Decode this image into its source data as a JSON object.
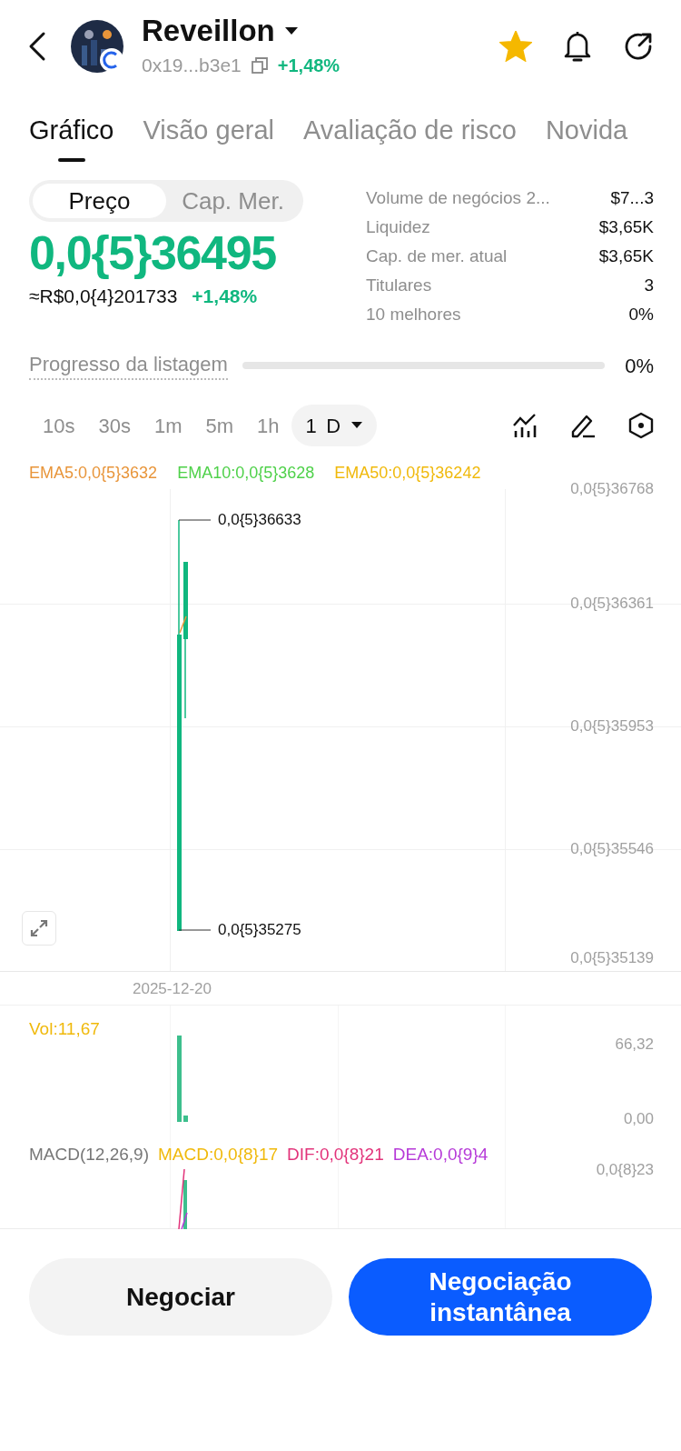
{
  "header": {
    "title": "Reveillon",
    "address": "0x19...b3e1",
    "change": "+1,48%",
    "favorite": true
  },
  "tabs": [
    {
      "label": "Gráfico",
      "selected": true
    },
    {
      "label": "Visão geral",
      "selected": false
    },
    {
      "label": "Avaliação de risco",
      "selected": false
    },
    {
      "label": "Novida",
      "selected": false
    }
  ],
  "price_toggle": [
    {
      "label": "Preço",
      "selected": true
    },
    {
      "label": "Cap. Mer.",
      "selected": false
    }
  ],
  "price": "0,0{5}36495",
  "price_brl": "≈R$0,0{4}201733",
  "price_change": "+1,48%",
  "stats": [
    {
      "label": "Volume de negócios 2...",
      "value": "$7...3"
    },
    {
      "label": "Liquidez",
      "value": "$3,65K"
    },
    {
      "label": "Cap. de mer. atual",
      "value": "$3,65K"
    },
    {
      "label": "Titulares",
      "value": "3"
    },
    {
      "label": "10 melhores",
      "value": "0%"
    }
  ],
  "listing_progress": {
    "label": "Progresso da listagem",
    "level": 0,
    "value": "0%"
  },
  "intervals": [
    {
      "label": "10s",
      "selected": false
    },
    {
      "label": "30s",
      "selected": false
    },
    {
      "label": "1m",
      "selected": false
    },
    {
      "label": "5m",
      "selected": false
    },
    {
      "label": "1h",
      "selected": false
    },
    {
      "label": "1 D",
      "selected": true
    }
  ],
  "chart": {
    "indicators": [
      {
        "text": "EMA5:0,0{5}3632",
        "color": "#e8953a"
      },
      {
        "text": "EMA10:0,0{5}3628",
        "color": "#4fd14a"
      },
      {
        "text": "EMA50:0,0{5}36242",
        "color": "#f0b90b"
      }
    ],
    "y_labels": [
      "0,0{5}36768",
      "0,0{5}36361",
      "0,0{5}35953",
      "0,0{5}35546",
      "0,0{5}35139"
    ],
    "high_label": "0,0{5}36633",
    "low_label": "0,0{5}35275",
    "date_label": "2025-12-20"
  },
  "volume": {
    "label": "Vol:11,67",
    "y_labels": [
      "66,32",
      "0,00"
    ]
  },
  "macd": {
    "label": "MACD(12,26,9)",
    "indicators": [
      {
        "text": "MACD:0,0{8}17",
        "color": "#f0b90b"
      },
      {
        "text": "DIF:0,0{8}21",
        "color": "#e2337a"
      },
      {
        "text": "DEA:0,0{9}4",
        "color": "#b63ad8"
      }
    ],
    "y_label": "0,0{8}23"
  },
  "buttons": [
    {
      "label": "Negociar",
      "kind": "secondary"
    },
    {
      "label": "Negociação instantânea",
      "kind": "primary"
    }
  ]
}
